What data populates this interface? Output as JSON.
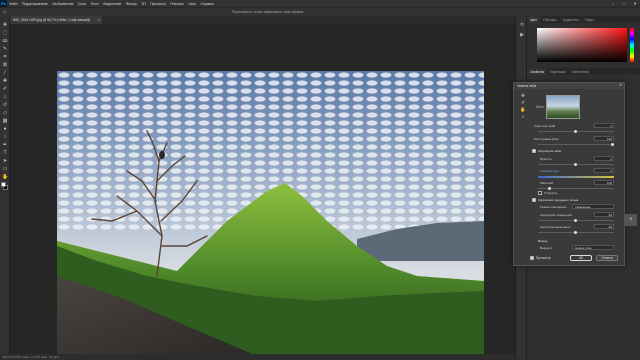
{
  "menubar": {
    "logo": "Ps",
    "items": [
      "Файл",
      "Редактирование",
      "Изображение",
      "Слои",
      "Текст",
      "Выделение",
      "Фильтр",
      "3D",
      "Просмотр",
      "Плагины",
      "Окно",
      "Справка"
    ],
    "window_controls": [
      "–",
      "□",
      "✕"
    ]
  },
  "optbar": {
    "hint": "Перетащите, чтобы нарисовать слой-эффект."
  },
  "document": {
    "tab_title": "IMG_3641-HDR.jpg @ 66,7% (Небо, Слой-маска/8)",
    "close": "×"
  },
  "statusbar": {
    "text": "66,67%   5 561 пикс. x 3 707 пикс. (72 ppi)"
  },
  "panels": {
    "color_tabs": [
      "Цвет",
      "Образцы",
      "Градиенты",
      "Узоры"
    ],
    "props_tabs": [
      "Свойства",
      "Коррекция",
      "Библиотеки"
    ]
  },
  "dialog": {
    "title": "Замена неба",
    "close": "✕",
    "sky_label": "Небо:",
    "shift_edge_label": "Сместить край",
    "shift_edge_value": "0",
    "fade_edge_label": "Растушевка края",
    "fade_edge_value": "100",
    "sky_adjust_section": "Коррекция неба",
    "brightness_label": "Яркость",
    "brightness_value": "0",
    "temperature_label": "Температура",
    "temperature_value": "0",
    "scale_label": "Масштаб",
    "scale_value": "100",
    "flip_label": "Отразить",
    "fg_section": "Коррекция переднего плана",
    "lighting_mode_label": "Режим освещения",
    "lighting_mode_value": "Умножение",
    "fg_lighting_label": "Коррекция освещения",
    "fg_lighting_value": "50",
    "color_adjust_label": "Корректировка цвета",
    "color_adjust_value": "50",
    "output_section": "Вывод",
    "output_to_label": "Вывод в",
    "output_to_value": "Новые слои",
    "preview_label": "Просмотр",
    "ok_label": "ОК",
    "cancel_label": "Отмена"
  },
  "icons": {
    "move": "move-icon",
    "marquee": "marquee-icon",
    "lasso": "lasso-icon",
    "magic": "quick-select-icon",
    "crop": "crop-icon",
    "frame": "frame-icon",
    "eyedropper": "eyedropper-icon",
    "heal": "healing-brush-icon",
    "brush": "brush-icon",
    "stamp": "clone-stamp-icon",
    "history": "history-brush-icon",
    "eraser": "eraser-icon",
    "gradient": "gradient-icon",
    "blur": "blur-icon",
    "dodge": "dodge-icon",
    "pen": "pen-icon",
    "type": "type-icon",
    "path": "path-select-icon",
    "shape": "shape-icon",
    "hand": "hand-icon",
    "zoom": "zoom-icon"
  }
}
